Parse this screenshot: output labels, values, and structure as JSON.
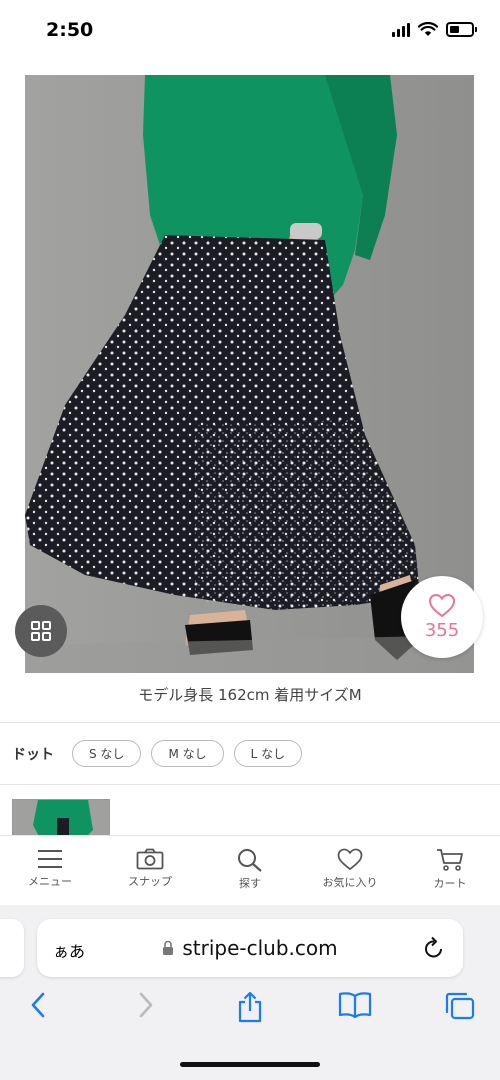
{
  "status_bar": {
    "time": "2:50",
    "icons": [
      "signal-icon",
      "wifi-icon",
      "battery-icon"
    ]
  },
  "product": {
    "image_alt": "black dotted tiered maxi skirt with green top",
    "favorite_count": "355",
    "caption": "モデル身長 162cm 着用サイズM"
  },
  "variants": {
    "color_label": "ドット",
    "sizes": [
      "S なし",
      "M なし",
      "L なし"
    ]
  },
  "bottom_nav": {
    "items": [
      {
        "label": "メニュー",
        "icon": "menu-icon"
      },
      {
        "label": "スナップ",
        "icon": "camera-icon"
      },
      {
        "label": "探す",
        "icon": "search-icon"
      },
      {
        "label": "お気に入り",
        "icon": "heart-icon"
      },
      {
        "label": "カート",
        "icon": "cart-icon"
      }
    ]
  },
  "browser": {
    "aa_label": "ぁあ",
    "url": "stripe-club.com",
    "toolbar_icons": [
      "back-icon",
      "forward-icon",
      "share-icon",
      "bookmarks-icon",
      "tabs-icon"
    ]
  },
  "colors": {
    "accent_pink": "#e8739a",
    "safari_blue": "#1a7cf5",
    "top_green": "#0f9361"
  }
}
